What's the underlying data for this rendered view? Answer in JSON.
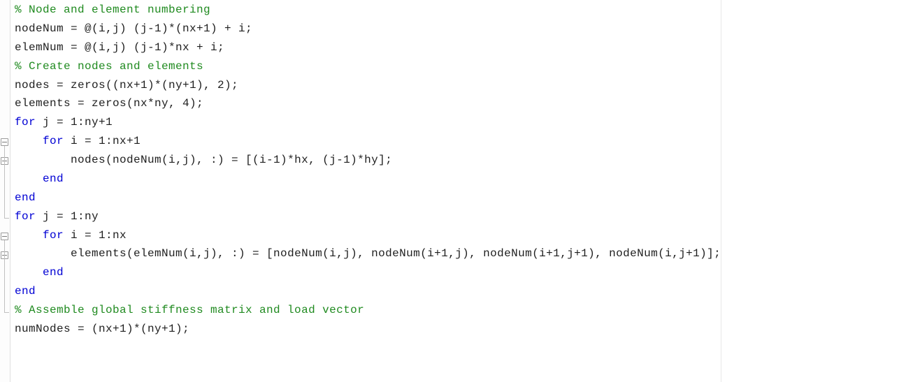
{
  "colors": {
    "comment": "#1f8a1f",
    "keyword": "#0000d4",
    "text": "#1e1e1e",
    "gutter_border": "#e0e0e0"
  },
  "lines": [
    {
      "indent": 0,
      "type": "comment",
      "tokens": [
        {
          "cls": "c",
          "t": "% Node and element numbering"
        }
      ]
    },
    {
      "indent": 0,
      "tokens": [
        {
          "cls": "t",
          "t": "nodeNum = @(i,j) (j-1)*(nx+1) + i;"
        }
      ]
    },
    {
      "indent": 0,
      "tokens": [
        {
          "cls": "t",
          "t": "elemNum = @(i,j) (j-1)*nx + i;"
        }
      ]
    },
    {
      "indent": 0,
      "tokens": [
        {
          "cls": "t",
          "t": ""
        }
      ]
    },
    {
      "indent": 0,
      "type": "comment",
      "tokens": [
        {
          "cls": "c",
          "t": "% Create nodes and elements"
        }
      ]
    },
    {
      "indent": 0,
      "tokens": [
        {
          "cls": "t",
          "t": "nodes = zeros((nx+1)*(ny+1), 2);"
        }
      ]
    },
    {
      "indent": 0,
      "tokens": [
        {
          "cls": "t",
          "t": "elements = zeros(nx*ny, 4);"
        }
      ]
    },
    {
      "indent": 0,
      "tokens": [
        {
          "cls": "k",
          "t": "for"
        },
        {
          "cls": "t",
          "t": " j = 1:ny+1"
        }
      ]
    },
    {
      "indent": 1,
      "tokens": [
        {
          "cls": "k",
          "t": "for"
        },
        {
          "cls": "t",
          "t": " i = 1:nx+1"
        }
      ]
    },
    {
      "indent": 2,
      "tokens": [
        {
          "cls": "t",
          "t": "nodes(nodeNum(i,j), :) = [(i-1)*hx, (j-1)*hy];"
        }
      ]
    },
    {
      "indent": 1,
      "tokens": [
        {
          "cls": "k",
          "t": "end"
        }
      ]
    },
    {
      "indent": 0,
      "tokens": [
        {
          "cls": "k",
          "t": "end"
        }
      ]
    },
    {
      "indent": 0,
      "tokens": [
        {
          "cls": "k",
          "t": "for"
        },
        {
          "cls": "t",
          "t": " j = 1:ny"
        }
      ]
    },
    {
      "indent": 1,
      "tokens": [
        {
          "cls": "k",
          "t": "for"
        },
        {
          "cls": "t",
          "t": " i = 1:nx"
        }
      ]
    },
    {
      "indent": 2,
      "tokens": [
        {
          "cls": "t",
          "t": "elements(elemNum(i,j), :) = [nodeNum(i,j), nodeNum(i+1,j), nodeNum(i+1,j+1), nodeNum(i,j+1)];"
        }
      ]
    },
    {
      "indent": 1,
      "tokens": [
        {
          "cls": "k",
          "t": "end"
        }
      ]
    },
    {
      "indent": 0,
      "tokens": [
        {
          "cls": "k",
          "t": "end"
        }
      ]
    },
    {
      "indent": 0,
      "tokens": [
        {
          "cls": "t",
          "t": ""
        }
      ]
    },
    {
      "indent": 0,
      "type": "comment",
      "tokens": [
        {
          "cls": "c",
          "t": "% Assemble global stiffness matrix and load vector"
        }
      ]
    },
    {
      "indent": 0,
      "tokens": [
        {
          "cls": "t",
          "t": "numNodes = (nx+1)*(ny+1);"
        }
      ]
    }
  ],
  "folds": [
    {
      "line": 8,
      "kind": "open"
    },
    {
      "line": 9,
      "kind": "open"
    },
    {
      "line": 12,
      "kind": "close"
    },
    {
      "line": 13,
      "kind": "open"
    },
    {
      "line": 14,
      "kind": "open"
    },
    {
      "line": 17,
      "kind": "close"
    }
  ]
}
